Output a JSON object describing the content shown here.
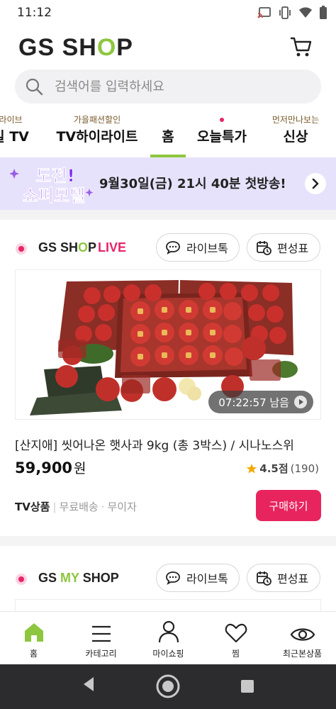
{
  "status_bar": {
    "time": "11:12",
    "icons": [
      "cast-icon",
      "vibrate-icon",
      "wifi-icon",
      "battery-icon"
    ]
  },
  "header": {
    "logo_prefix": "GS SH",
    "logo_o": "O",
    "logo_suffix": "P",
    "cart_icon": "cart-icon"
  },
  "search": {
    "placeholder": "검색어를 입력하세요"
  },
  "tabs": [
    {
      "sub": "라이브",
      "label": "일 TV"
    },
    {
      "sub": "가을패션할인",
      "label": "TV하이라이트"
    },
    {
      "sub": "",
      "label": "홈",
      "active": true
    },
    {
      "sub": "",
      "label": "오늘특가",
      "dot": true
    },
    {
      "sub": "먼저만나보는",
      "label": "신상"
    }
  ],
  "banner": {
    "art_line1": "도전!",
    "art_line2": "쇼퍼모델",
    "text": "9월30일(금) 21시 40분 첫방송!",
    "bg_color": "#e7e2fb"
  },
  "live_section": {
    "channel_prefix": "GS SH",
    "channel_o": "O",
    "channel_suffix": "P",
    "channel_live": "LIVE",
    "livetalk_label": "라이브톡",
    "schedule_label": "편성표"
  },
  "product": {
    "timer": "07:22:57 남음",
    "title": "[산지애] 씻어나온 햇사과 9kg (총 3박스) / 시나노스위",
    "price": "59,900",
    "currency": "원",
    "rating_score": "4.5점",
    "rating_count": "(190)",
    "tag_tv": "TV상품",
    "tag_shipping": "무료배송",
    "tag_interest": "무이자",
    "buy_label": "구매하기"
  },
  "myshop_section": {
    "channel_prefix": "GS ",
    "channel_my": "MY",
    "channel_suffix": " SHOP",
    "livetalk_label": "라이브톡",
    "schedule_label": "편성표"
  },
  "bottom_nav": [
    {
      "label": "홈",
      "icon": "home-icon",
      "active": true
    },
    {
      "label": "카테고리",
      "icon": "menu-icon"
    },
    {
      "label": "마이쇼핑",
      "icon": "person-icon"
    },
    {
      "label": "찜",
      "icon": "heart-icon"
    },
    {
      "label": "최근본상품",
      "icon": "eye-icon"
    }
  ],
  "colors": {
    "brand_green": "#8dc63f",
    "accent_pink": "#e8236a"
  }
}
